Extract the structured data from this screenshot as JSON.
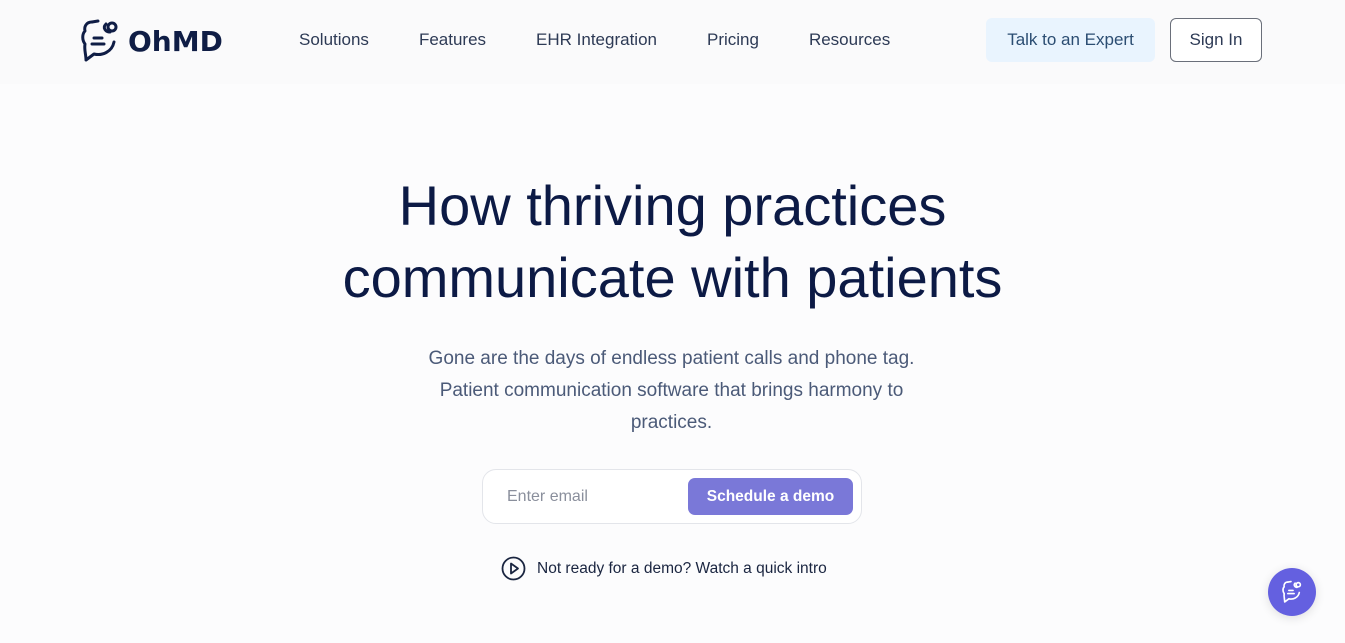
{
  "brand": {
    "name": "OhMD",
    "primary_color": "#0f1d45",
    "accent_color": "#7a78d8"
  },
  "nav": {
    "items": [
      {
        "label": "Solutions"
      },
      {
        "label": "Features"
      },
      {
        "label": "EHR Integration"
      },
      {
        "label": "Pricing"
      },
      {
        "label": "Resources"
      }
    ],
    "talk_expert_label": "Talk to an Expert",
    "sign_in_label": "Sign In"
  },
  "hero": {
    "title_line1": "How thriving practices",
    "title_line2": "communicate with patients",
    "subtitle": "Gone are the days of endless patient calls and phone tag. Patient communication software that brings harmony to practices.",
    "email_placeholder": "Enter email",
    "email_value": "",
    "demo_button_label": "Schedule a demo",
    "intro_link_label": "Not ready for a demo? Watch a quick intro"
  },
  "icons": {
    "logo": "chat-bubble-stethoscope-icon",
    "intro": "play-circle-icon",
    "chat_fab": "chat-bubble-stethoscope-icon"
  }
}
